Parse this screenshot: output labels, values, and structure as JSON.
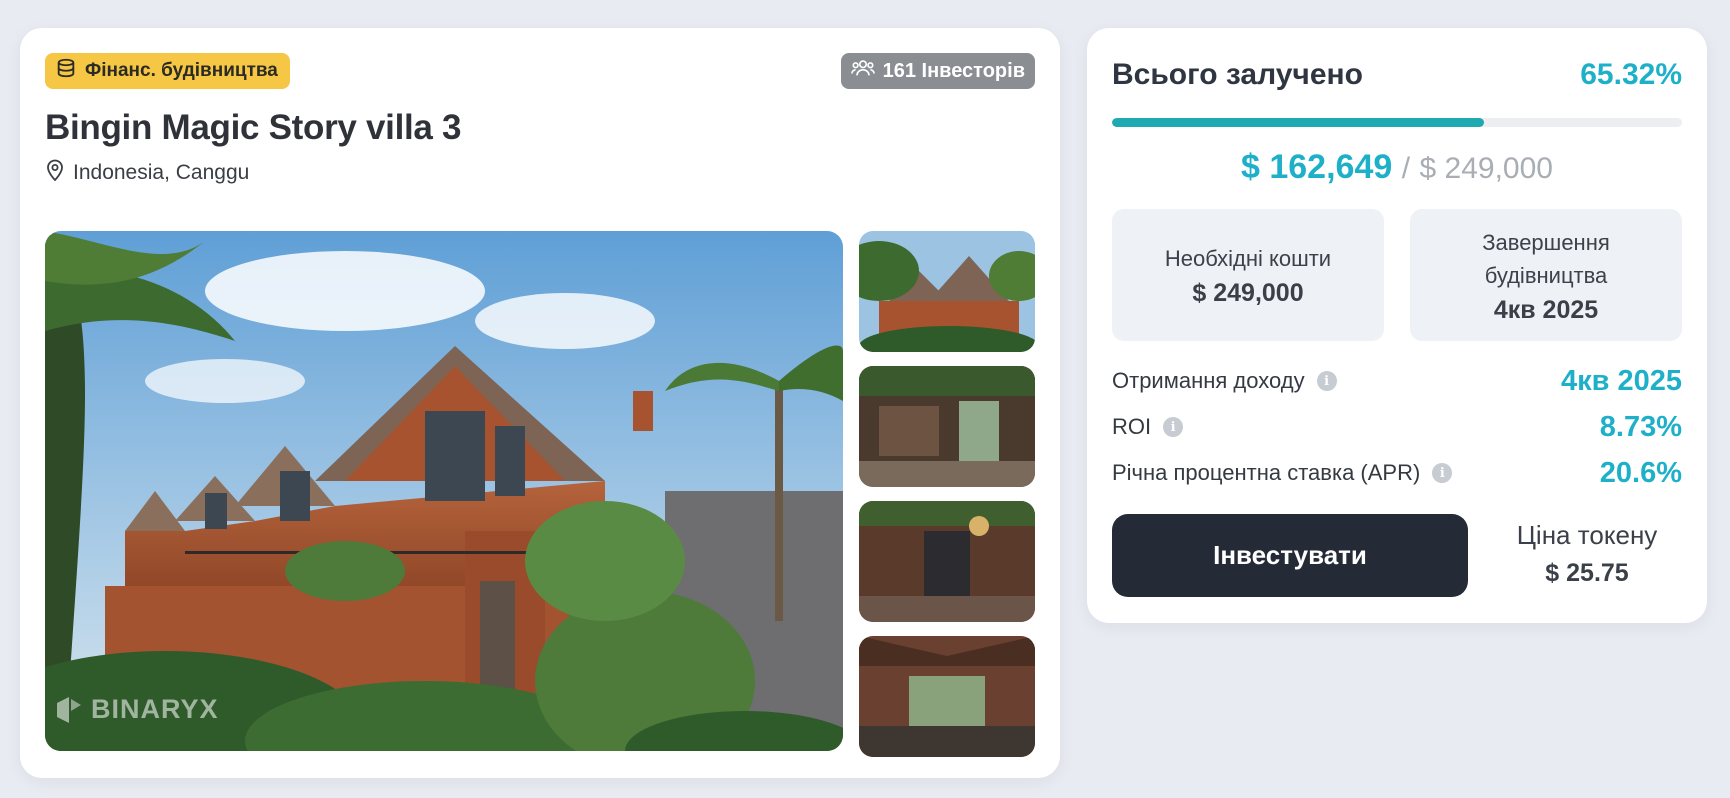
{
  "project": {
    "category_badge": "Фінанс. будівництва",
    "investors_badge": "161 Інвесторів",
    "title": "Bingin Magic Story villa 3",
    "location": "Indonesia, Canggu",
    "watermark": "BINARYX",
    "thumbnails": [
      "thumb-exterior",
      "thumb-kitchen",
      "thumb-lounge",
      "thumb-bedroom"
    ]
  },
  "funding": {
    "label": "Всього залучено",
    "percent": "65.32%",
    "progress_fraction": 0.6532,
    "raised": "$ 162,649",
    "separator": "/",
    "target": "$ 249,000"
  },
  "boxes": {
    "required_label": "Необхідні кошти",
    "required_value": "$ 249,000",
    "completion_label": "Завершення будівництва",
    "completion_value": "4кв 2025"
  },
  "stats": [
    {
      "label": "Отримання доходу",
      "value": "4кв 2025"
    },
    {
      "label": "ROI",
      "value": "8.73%"
    },
    {
      "label": "Річна процентна ставка (APR)",
      "value": "20.6%"
    }
  ],
  "actions": {
    "invest_label": "Інвестувати",
    "token_price_label": "Ціна токену",
    "token_price_value": "$ 25.75"
  },
  "colors": {
    "accent": "#1fb0c9",
    "progress": "#1eaab0",
    "badge_yellow": "#f6c744",
    "button_dark": "#242a36"
  }
}
